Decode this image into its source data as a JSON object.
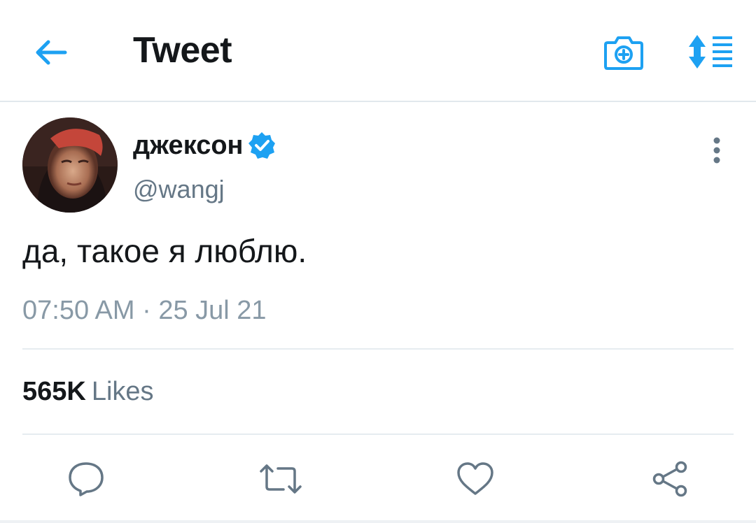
{
  "header": {
    "title": "Tweet",
    "back_icon": "arrow-left-icon",
    "camera_icon": "camera-add-icon",
    "sort_icon": "sort-list-icon"
  },
  "tweet": {
    "display_name": "джексон",
    "handle": "@wangj",
    "verified": true,
    "text": "да, такое я люблю.",
    "timestamp": "07:50 AM · 25 Jul 21",
    "likes_count": "565K",
    "likes_label": "Likes"
  },
  "actions": [
    {
      "name": "reply",
      "icon": "comment-icon"
    },
    {
      "name": "retweet",
      "icon": "retweet-icon"
    },
    {
      "name": "like",
      "icon": "heart-icon"
    },
    {
      "name": "share",
      "icon": "share-icon"
    }
  ],
  "colors": {
    "accent": "#1da1f2",
    "text_primary": "#14171a",
    "text_secondary": "#657786",
    "divider": "#e6ecf0"
  }
}
